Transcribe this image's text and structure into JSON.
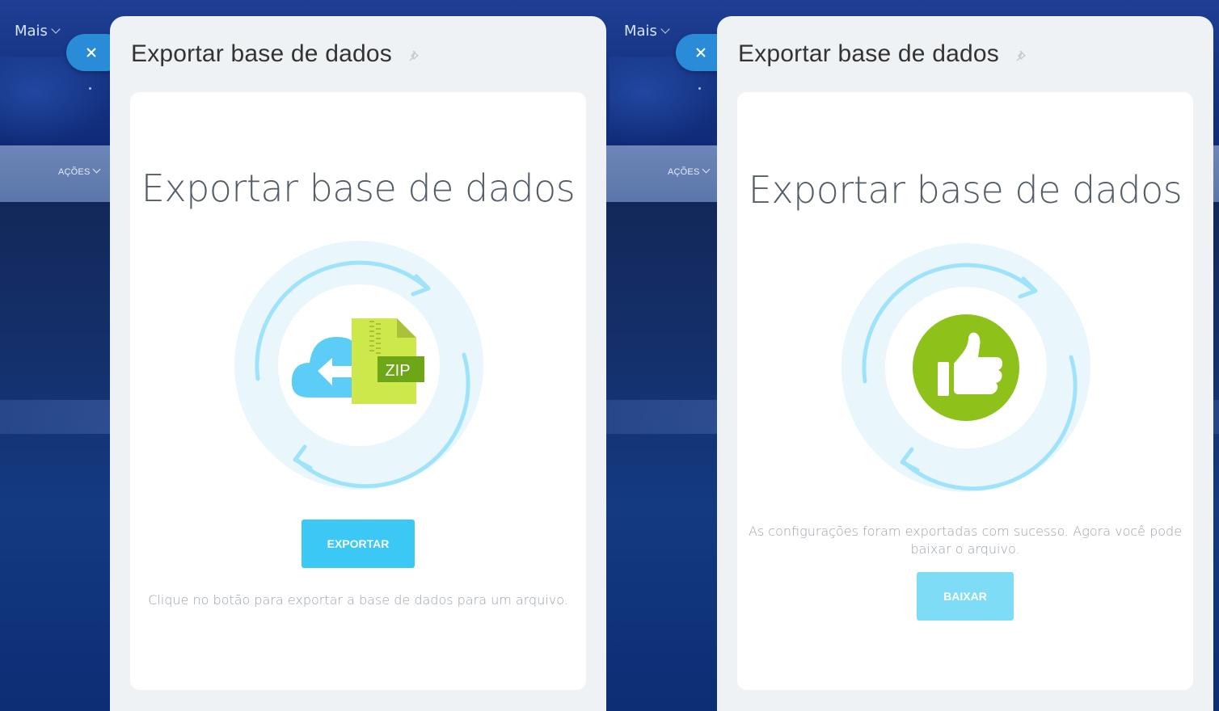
{
  "panels": [
    {
      "background": {
        "menu_more": "Mais",
        "actions_label": "AÇÕES"
      },
      "slider": {
        "title": "Exportar base de dados",
        "card_title": "Exportar base de dados",
        "illustration": "cloud-zip-export-icon",
        "zip_label": "ZIP",
        "button_label": "EXPORTAR",
        "hint": "Clique no botão para exportar a base de dados para um arquivo."
      }
    },
    {
      "background": {
        "menu_more": "Mais",
        "actions_label": "AÇÕES"
      },
      "slider": {
        "title": "Exportar base de dados",
        "card_title": "Exportar base de dados",
        "illustration": "thumbs-up-success-icon",
        "message_line1": "As configurações foram exportadas com sucesso. Agora você pode",
        "message_line2": "baixar o arquivo.",
        "button_label": "BAIXAR"
      }
    }
  ],
  "colors": {
    "accent_button": "#3bc8f5",
    "accent_button_light": "#7fdcf7",
    "close_button": "#2a8bd8",
    "zip_green": "#cde84a",
    "thumb_green": "#8ec21b",
    "cloud_blue": "#5bcdf6"
  }
}
